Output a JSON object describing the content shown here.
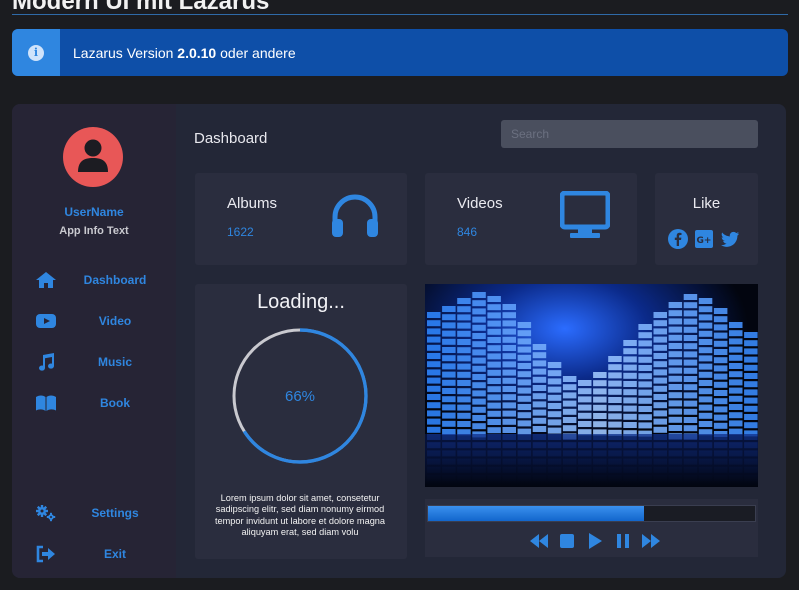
{
  "page": {
    "heading": "Modern UI mit Lazarus"
  },
  "banner": {
    "text_prefix": "Lazarus Version ",
    "version": "2.0.10",
    "text_suffix": " oder andere",
    "icon": "info-icon"
  },
  "sidebar": {
    "username": "UserName",
    "app_info": "App Info Text",
    "items": [
      {
        "label": "Dashboard",
        "icon": "home-icon"
      },
      {
        "label": "Video",
        "icon": "youtube-icon"
      },
      {
        "label": "Music",
        "icon": "music-note-icon"
      },
      {
        "label": "Book",
        "icon": "book-icon"
      }
    ],
    "bottom_items": [
      {
        "label": "Settings",
        "icon": "gears-icon"
      },
      {
        "label": "Exit",
        "icon": "sign-out-icon"
      }
    ]
  },
  "header": {
    "title": "Dashboard",
    "search_placeholder": "Search"
  },
  "stats": {
    "albums": {
      "label": "Albums",
      "value": "1622",
      "icon": "headphones-icon"
    },
    "videos": {
      "label": "Videos",
      "value": "846",
      "icon": "monitor-icon"
    },
    "like": {
      "label": "Like",
      "icons": [
        "facebook-icon",
        "google-plus-icon",
        "twitter-icon"
      ]
    }
  },
  "loading": {
    "title": "Loading...",
    "percent_text": "66%",
    "percent": 66,
    "description": "Lorem ipsum dolor sit amet, consetetur sadipscing elitr, sed diam nonumy eirmod tempor invidunt ut labore et dolore magna aliquyam erat, sed diam volu"
  },
  "player": {
    "progress": 0.66,
    "controls": [
      "rewind-icon",
      "stop-icon",
      "play-icon",
      "pause-icon",
      "fast-forward-icon"
    ]
  },
  "colors": {
    "accent": "#2f86e0",
    "avatar": "#e85757",
    "banner": "#0e4fa8",
    "sidebar": "#262435",
    "panel": "#2a2d3e"
  }
}
